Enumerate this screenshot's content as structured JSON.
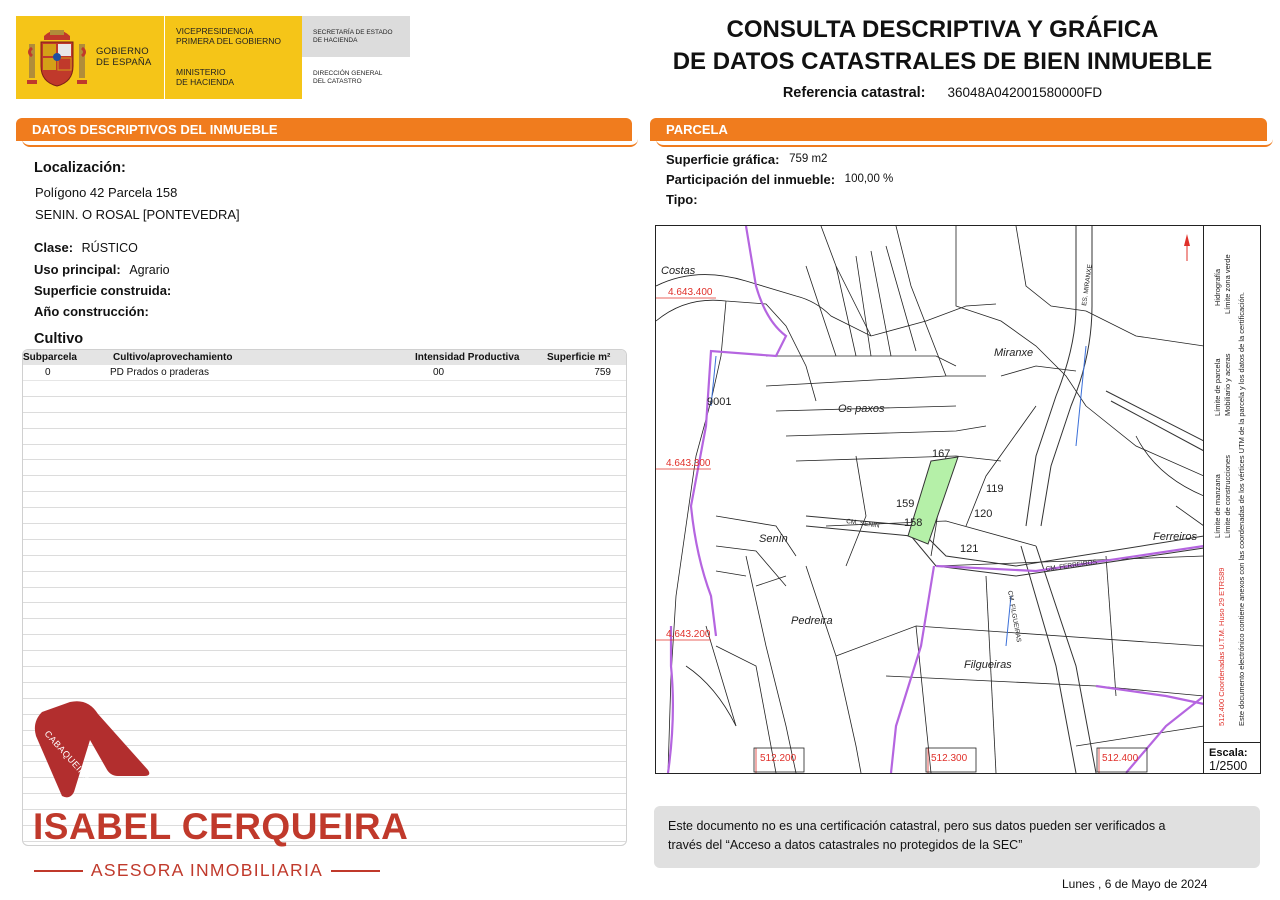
{
  "header": {
    "gov_line1": "GOBIERNO",
    "gov_line2": "DE ESPAÑA",
    "vice_line1": "VICEPRESIDENCIA",
    "vice_line2": "PRIMERA DEL GOBIERNO",
    "min_line1": "MINISTERIO",
    "min_line2": "DE HACIENDA",
    "sec_line1": "SECRETARÍA DE ESTADO",
    "sec_line2": "DE HACIENDA",
    "dir_line1": "DIRECCIÓN GENERAL",
    "dir_line2": "DEL CATASTRO",
    "title_line1": "CONSULTA DESCRIPTIVA Y GRÁFICA",
    "title_line2": "DE DATOS CATASTRALES DE BIEN INMUEBLE",
    "ref_label": "Referencia catastral:",
    "ref_value": "36048A042001580000FD"
  },
  "left": {
    "section_title_a": "DATOS DESCRIPTIVOS DEL ",
    "section_title_b": "INMUEBLE",
    "loc_label": "Localización:",
    "loc_line1": "Polígono 42 Parcela 158",
    "loc_line2": "SENIN. O ROSAL [PONTEVEDRA]",
    "clase_label": "Clase:",
    "clase_value": "RÚSTICO",
    "uso_label": "Uso principal:",
    "uso_value": "Agrario",
    "sup_label": "Superficie construida:",
    "anio_label": "Año construcción:",
    "cultivo_title": "Cultivo",
    "table_headers": [
      "Subparcela",
      "Cultivo/aprovechamiento",
      "Intensidad Productiva",
      "Superficie m²"
    ],
    "table_rows": [
      {
        "subparcela": "0",
        "cultivo": "PD Prados o praderas",
        "intensidad": "00",
        "superficie": "759"
      }
    ]
  },
  "agency": {
    "mark_text": "CABAQUEIRA",
    "name": "ISABEL CERQUEIRA",
    "subtitle": "ASESORA INMOBILIARIA",
    "color": "#c0392b"
  },
  "right": {
    "section_title": "PARCELA",
    "sup_label": "Superficie gráfica:",
    "sup_value": "759 m2",
    "part_label": "Participación del inmueble:",
    "part_value": "100,00 %",
    "tipo_label": "Tipo:"
  },
  "map": {
    "places": [
      "Costas",
      "Miranxe",
      "Os paxos",
      "Senín",
      "Pedreira",
      "Ferreiros",
      "Filgueiras"
    ],
    "parcel_numbers": [
      "9001",
      "167",
      "159",
      "158",
      "119",
      "120",
      "121"
    ],
    "coords_y": [
      "4.643.400",
      "4.643.300",
      "4.643.200"
    ],
    "coords_x": [
      "512.200",
      "512.300",
      "512.400"
    ],
    "streets": [
      "CM. SENIN",
      "CM. FERREIROS",
      "ES. MIRANXE",
      "CM. FILGUEIRAS"
    ],
    "highlight_color": "#b5f0a8",
    "legend": {
      "hidro": "Hidrografía",
      "verde": "Límite zona verde",
      "parcela": "Límite de parcela",
      "mobiliario": "Mobiliario y aceras",
      "manzana": "Límite de manzana",
      "construcciones": "Límite de construcciones",
      "utm": "512.400 Coordenadas U.T.M. Huso 29 ETRS89",
      "disclaimer": "Este documento electrónico contiene anexos con las coordenadas de los vértices UTM de la parcela y los datos de la certificación."
    },
    "scale_label": "Escala:",
    "scale_value": "1/2500"
  },
  "footer": {
    "notice_line1": "Este documento no es una certificación catastral, pero sus datos pueden ser verificados a",
    "notice_line2": "través del “Acceso a datos catastrales no protegidos de la SEC”",
    "date": "Lunes , 6 de Mayo de 2024"
  }
}
